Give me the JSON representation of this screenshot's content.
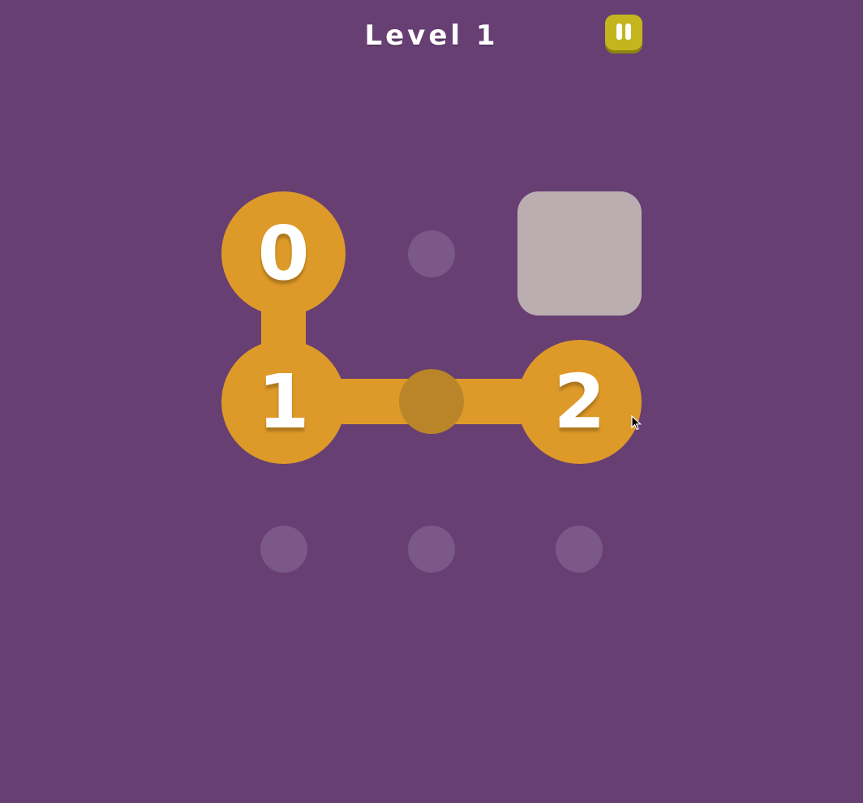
{
  "header": {
    "level_title": "Level 1",
    "pause_icon": "pause-icon"
  },
  "board": {
    "columns": 3,
    "rows": 3,
    "cells": [
      {
        "row": 1,
        "col": 1,
        "kind": "numbered-node",
        "label": "0"
      },
      {
        "row": 1,
        "col": 2,
        "kind": "empty-dot"
      },
      {
        "row": 1,
        "col": 3,
        "kind": "blocked-tile"
      },
      {
        "row": 2,
        "col": 1,
        "kind": "numbered-node",
        "label": "1"
      },
      {
        "row": 2,
        "col": 2,
        "kind": "path-dot"
      },
      {
        "row": 2,
        "col": 3,
        "kind": "numbered-node",
        "label": "2"
      },
      {
        "row": 3,
        "col": 1,
        "kind": "empty-dot"
      },
      {
        "row": 3,
        "col": 2,
        "kind": "empty-dot"
      },
      {
        "row": 3,
        "col": 3,
        "kind": "empty-dot"
      }
    ],
    "path_order": [
      "0",
      "1",
      "2"
    ]
  },
  "colors": {
    "background": "#673f73",
    "node": "#de9a28",
    "path_dot": "#b98528",
    "empty_dot": "#7b5888",
    "blocked_tile": "#baaeb0",
    "pause_button": "#c4b51e"
  }
}
